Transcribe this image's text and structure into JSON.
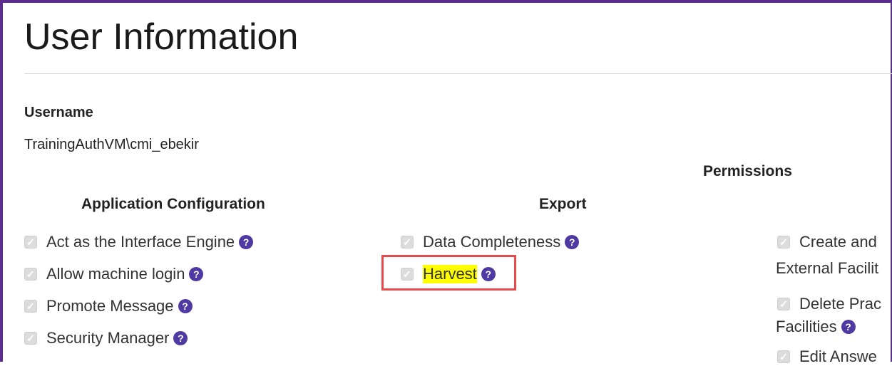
{
  "header": {
    "title": "User Information"
  },
  "user": {
    "username_label": "Username",
    "username_value": "TrainingAuthVM\\cmi_ebekir"
  },
  "sections": {
    "permissions_heading": "Permissions",
    "app_config_heading": "Application Configuration",
    "export_heading": "Export"
  },
  "app_config": {
    "items": [
      {
        "label": "Act as the Interface Engine",
        "checked": true
      },
      {
        "label": "Allow machine login",
        "checked": true
      },
      {
        "label": "Promote Message",
        "checked": true
      },
      {
        "label": "Security Manager",
        "checked": true
      }
    ]
  },
  "export": {
    "items": [
      {
        "label": "Data Completeness",
        "checked": true
      },
      {
        "label": "Harvest",
        "checked": true
      }
    ]
  },
  "permissions": {
    "items": [
      {
        "line1": "Create and",
        "line2": "External Facilit"
      },
      {
        "line1": "Delete Prac",
        "line2": "Facilities"
      },
      {
        "line1": "Edit Answe"
      }
    ]
  },
  "icons": {
    "help": "question-circle-icon",
    "check": "check-icon"
  },
  "colors": {
    "help_icon": "#4f3aa3",
    "frame": "#5b2d8e",
    "callout": "#e64a4a",
    "highlight": "#ffff00"
  }
}
